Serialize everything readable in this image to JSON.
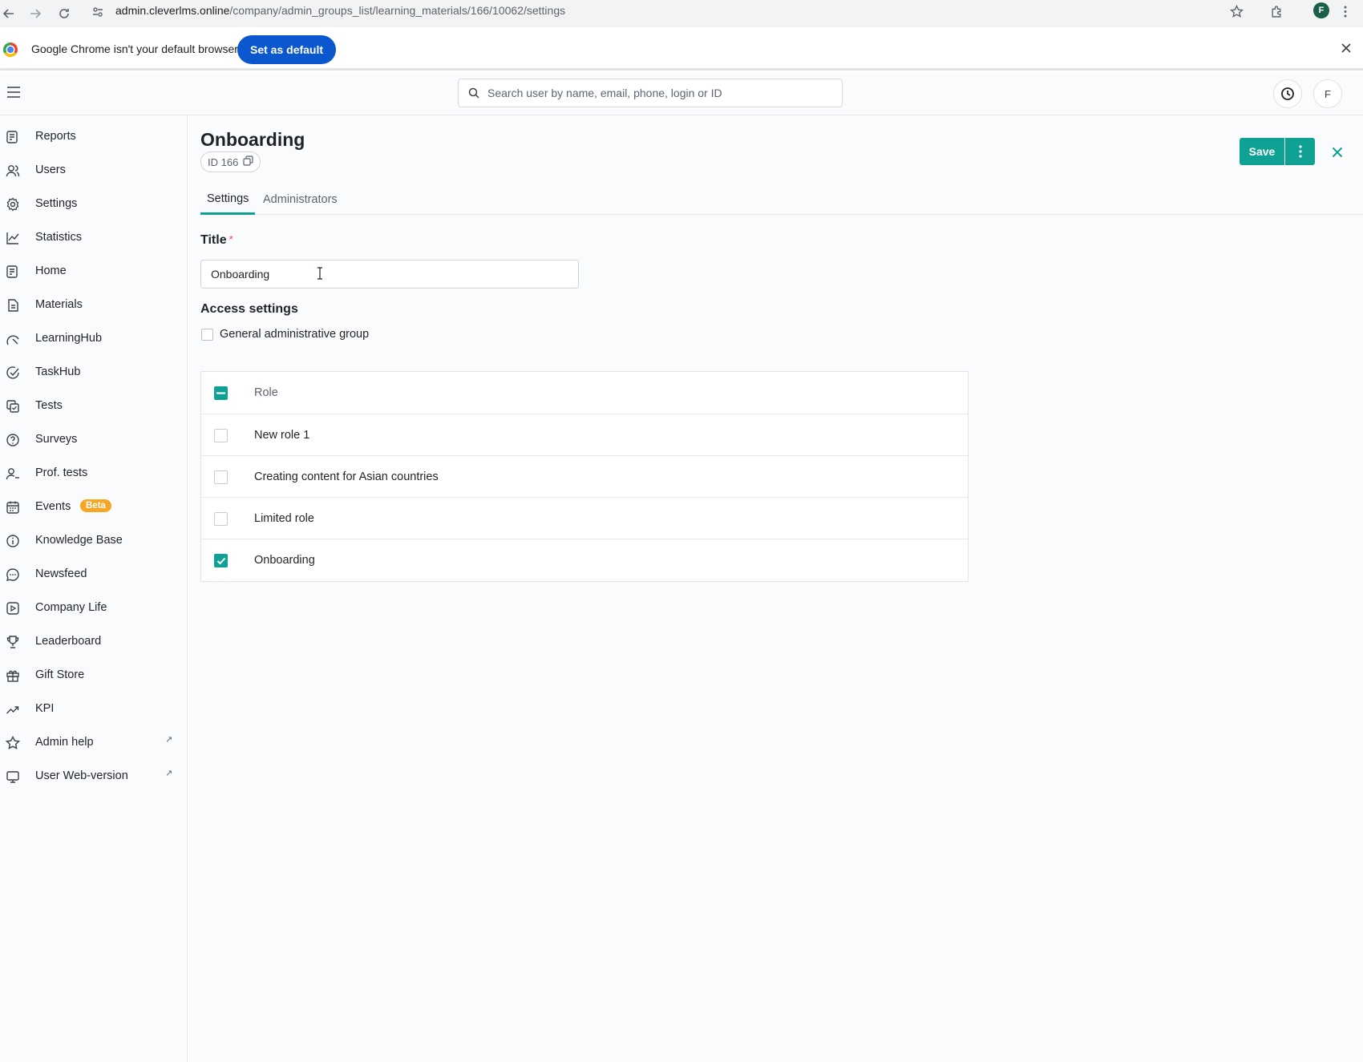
{
  "browser": {
    "url_host": "admin.cleverlms.online",
    "url_path": "/company/admin_groups_list/learning_materials/166/10062/settings",
    "profile_initial": "F"
  },
  "default_bar": {
    "message": "Google Chrome isn't your default browser",
    "button": "Set as default"
  },
  "header": {
    "search_placeholder": "Search user by name, email, phone, login or ID",
    "avatar_initial": "F"
  },
  "sidebar": {
    "items": [
      {
        "label": "Reports",
        "icon": "reports-icon"
      },
      {
        "label": "Users",
        "icon": "users-icon"
      },
      {
        "label": "Settings",
        "icon": "settings-icon"
      },
      {
        "label": "Statistics",
        "icon": "statistics-icon"
      },
      {
        "label": "Home",
        "icon": "home-icon"
      },
      {
        "label": "Materials",
        "icon": "materials-icon"
      },
      {
        "label": "LearningHub",
        "icon": "learninghub-icon"
      },
      {
        "label": "TaskHub",
        "icon": "taskhub-icon"
      },
      {
        "label": "Tests",
        "icon": "tests-icon"
      },
      {
        "label": "Surveys",
        "icon": "surveys-icon"
      },
      {
        "label": "Prof. tests",
        "icon": "prof-tests-icon"
      },
      {
        "label": "Events",
        "icon": "events-icon",
        "badge": "Beta"
      },
      {
        "label": "Knowledge Base",
        "icon": "info-icon"
      },
      {
        "label": "Newsfeed",
        "icon": "newsfeed-icon"
      },
      {
        "label": "Company Life",
        "icon": "company-life-icon"
      },
      {
        "label": "Leaderboard",
        "icon": "trophy-icon"
      },
      {
        "label": "Gift Store",
        "icon": "gift-icon"
      },
      {
        "label": "KPI",
        "icon": "kpi-icon"
      },
      {
        "label": "Admin help",
        "icon": "star-icon",
        "external": true
      },
      {
        "label": "User Web-version",
        "icon": "monitor-icon",
        "external": true
      }
    ]
  },
  "page": {
    "title": "Onboarding",
    "id_label": "ID 166",
    "save_label": "Save",
    "tabs": [
      "Settings",
      "Administrators"
    ],
    "active_tab": "Settings",
    "title_field_label": "Title",
    "required_mark": "*",
    "title_value": "Onboarding",
    "access_settings_label": "Access settings",
    "general_group_label": "General administrative group",
    "general_group_checked": false
  },
  "roles_table": {
    "header": "Role",
    "header_state": "indeterminate",
    "rows": [
      {
        "label": "New role 1",
        "checked": false
      },
      {
        "label": "Creating content for Asian countries",
        "checked": false
      },
      {
        "label": "Limited role",
        "checked": false
      },
      {
        "label": "Onboarding",
        "checked": true
      }
    ]
  },
  "colors": {
    "accent": "#10a195",
    "chrome_button": "#0b57d0",
    "beta_badge": "#f5a623",
    "required": "#e5484d"
  }
}
